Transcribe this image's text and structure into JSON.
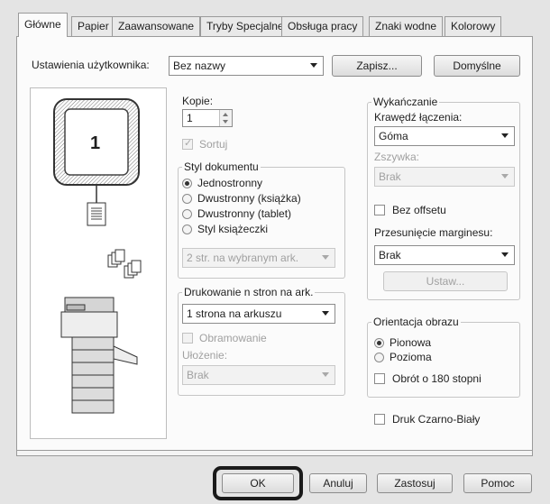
{
  "tabs": [
    {
      "label": "Główne",
      "active": true
    },
    {
      "label": "Papier"
    },
    {
      "label": "Zaawansowane"
    },
    {
      "label": "Tryby Specjalne"
    },
    {
      "label": "Obsługa pracy"
    },
    {
      "label": "Znaki wodne"
    },
    {
      "label": "Kolorowy"
    }
  ],
  "user_settings": {
    "label": "Ustawienia użytkownika:",
    "value": "Bez nazwy",
    "save_label": "Zapisz...",
    "default_label": "Domyślne"
  },
  "preview": {
    "page_number": "1"
  },
  "copies": {
    "label": "Kopie:",
    "value": "1",
    "collate_label": "Sortuj"
  },
  "document_style": {
    "title": "Styl dokumentu",
    "options": [
      "Jednostronny",
      "Dwustronny (książka)",
      "Dwustronny (tablet)",
      "Styl książeczki"
    ],
    "selected": "Jednostronny",
    "booklet_value": "2 str. na wybranym ark."
  },
  "n_up": {
    "title": "Drukowanie n stron na ark.",
    "value": "1 strona na arkuszu",
    "border_label": "Obramowanie",
    "layout_label": "Ułożenie:",
    "layout_value": "Brak"
  },
  "finishing": {
    "title": "Wykańczanie",
    "binding_edge_label": "Krawędź łączenia:",
    "binding_edge_value": "Góma",
    "staple_label": "Zszywka:",
    "staple_value": "Brak",
    "no_offset_label": "Bez offsetu",
    "margin_shift_label": "Przesunięcie marginesu:",
    "margin_shift_value": "Brak",
    "settings_label": "Ustaw..."
  },
  "orientation": {
    "title": "Orientacja obrazu",
    "options": [
      "Pionowa",
      "Pozioma"
    ],
    "selected": "Pionowa",
    "rotate_label": "Obrót o 180 stopni"
  },
  "bw_print_label": "Druk Czarno-Biały",
  "buttons": {
    "ok": "OK",
    "cancel": "Anuluj",
    "apply": "Zastosuj",
    "help": "Pomoc"
  },
  "colors": {
    "ok_highlight": "#1a1a1a"
  }
}
